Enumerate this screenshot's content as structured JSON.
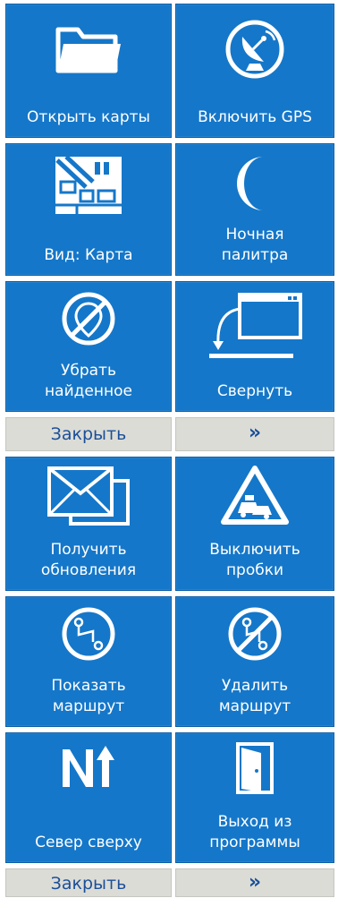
{
  "panel1": {
    "tiles": [
      {
        "label": "Открыть карты",
        "icon": "folder-icon"
      },
      {
        "label": "Включить GPS",
        "icon": "satellite-dish-icon"
      },
      {
        "label": "Вид: Карта",
        "icon": "map-icon"
      },
      {
        "label": "Ночная\nпалитра",
        "icon": "crescent-moon-icon"
      },
      {
        "label": "Убрать\nнайденное",
        "icon": "clear-found-icon"
      },
      {
        "label": "Свернуть",
        "icon": "minimize-window-icon"
      }
    ],
    "close_label": "Закрыть",
    "more_label": "»"
  },
  "panel2": {
    "tiles": [
      {
        "label": "Получить\nобновления",
        "icon": "envelopes-icon"
      },
      {
        "label": "Выключить\nпробки",
        "icon": "traffic-warning-icon"
      },
      {
        "label": "Показать\nмаршрут",
        "icon": "route-icon"
      },
      {
        "label": "Удалить\nмаршрут",
        "icon": "delete-route-icon"
      },
      {
        "label": "Север сверху",
        "icon": "north-up-icon"
      },
      {
        "label": "Выход из\nпрограммы",
        "icon": "exit-door-icon"
      }
    ],
    "close_label": "Закрыть",
    "more_label": "»"
  },
  "colors": {
    "tile_bg": "#1577c9",
    "bar_bg": "#dcdcd6",
    "bar_text": "#1a4f99",
    "text": "#ffffff"
  }
}
